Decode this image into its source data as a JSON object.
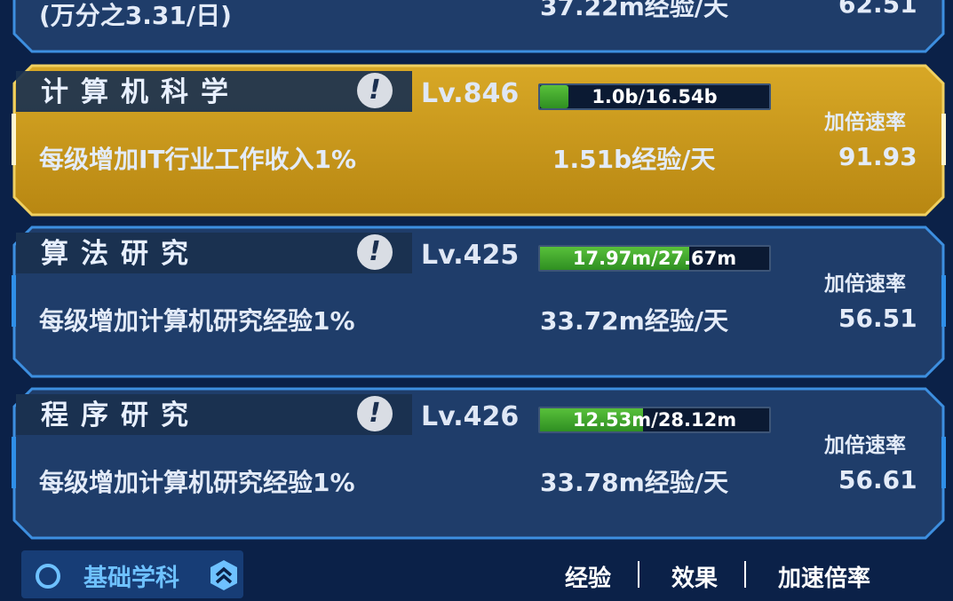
{
  "top_partial": {
    "desc": "(万分之3.31/日)",
    "rate": "37.22m经验/天",
    "mul": "62.51"
  },
  "cards": [
    {
      "title": "计算机科学",
      "level": "Lv.846",
      "progress_text": "1.0b/16.54b",
      "progress_fraction": 0.06,
      "desc": "每级增加IT行业工作收入1%",
      "rate": "1.51b经验/天",
      "mul_label": "加倍速率",
      "mul": "91.93",
      "highlighted": true
    },
    {
      "title": "算法研究",
      "level": "Lv.425",
      "progress_text": "17.97m/27.67m",
      "progress_fraction": 0.65,
      "desc": "每级增加计算机研究经验1%",
      "rate": "33.72m经验/天",
      "mul_label": "加倍速率",
      "mul": "56.51",
      "highlighted": false
    },
    {
      "title": "程序研究",
      "level": "Lv.426",
      "progress_text": "12.53m/28.12m",
      "progress_fraction": 0.45,
      "desc": "每级增加计算机研究经验1%",
      "rate": "33.78m经验/天",
      "mul_label": "加倍速率",
      "mul": "56.61",
      "highlighted": false
    }
  ],
  "bottom": {
    "category": "基础学科",
    "tabs": [
      "经验",
      "效果",
      "加速倍率"
    ]
  },
  "colors": {
    "background": "#0b2148",
    "card_fill": "#1f3d6a",
    "card_border": "#3d8fe0",
    "highlight_fill": "#c79a1a",
    "highlight_border": "#f0d060",
    "progress_green": "#4bb532",
    "accent_blue": "#6ec1ff"
  }
}
